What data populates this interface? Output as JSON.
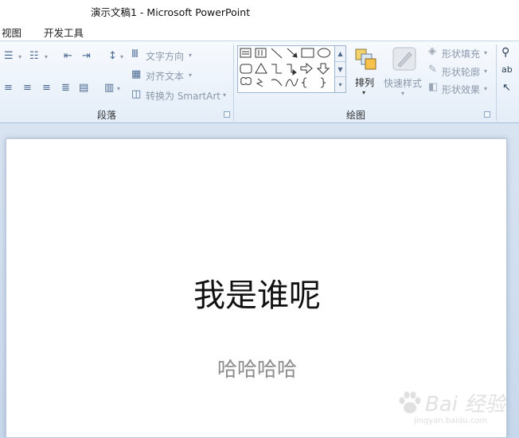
{
  "window": {
    "title": "演示文稿1  -  Microsoft PowerPoint"
  },
  "menu": {
    "tabs": [
      "视图",
      "开发工具"
    ]
  },
  "ribbon": {
    "paragraph": {
      "label": "段落",
      "text_direction": "文字方向",
      "align_text": "对齐文本",
      "convert_smartart": "转换为 SmartArt"
    },
    "drawing": {
      "label": "绘图",
      "arrange": "排列",
      "quick_styles": "快速样式",
      "shape_fill": "形状填充",
      "shape_outline": "形状轮廓",
      "shape_effects": "形状效果"
    }
  },
  "slide": {
    "title": "我是谁呢",
    "subtitle": "哈哈哈哈"
  },
  "watermark": {
    "text": "Bai 经验",
    "url": "jingyan.baidu.com"
  },
  "colors": {
    "ribbon_top": "#f7fafe",
    "ribbon_bottom": "#e4edf8",
    "workspace": "#d4e1f1",
    "subtitle": "#8c8c8c"
  }
}
